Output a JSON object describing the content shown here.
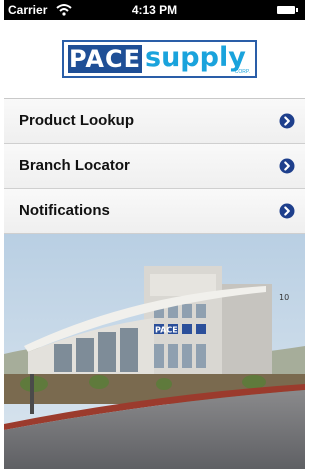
{
  "status_bar": {
    "carrier": "Carrier",
    "time": "4:13 PM"
  },
  "logo": {
    "part1": "PACE",
    "part2": "supply",
    "corp": "CORP."
  },
  "menu": {
    "items": [
      {
        "label": "Product Lookup",
        "icon": "chevron-right-circle-icon"
      },
      {
        "label": "Branch Locator",
        "icon": "chevron-right-circle-icon"
      },
      {
        "label": "Notifications",
        "icon": "chevron-right-circle-icon"
      }
    ]
  },
  "building_sign": "PACE",
  "building_number": "10",
  "colors": {
    "brand_blue": "#1f4f96",
    "brand_light_blue": "#1aa3dc",
    "chevron": "#1e3f8c"
  }
}
